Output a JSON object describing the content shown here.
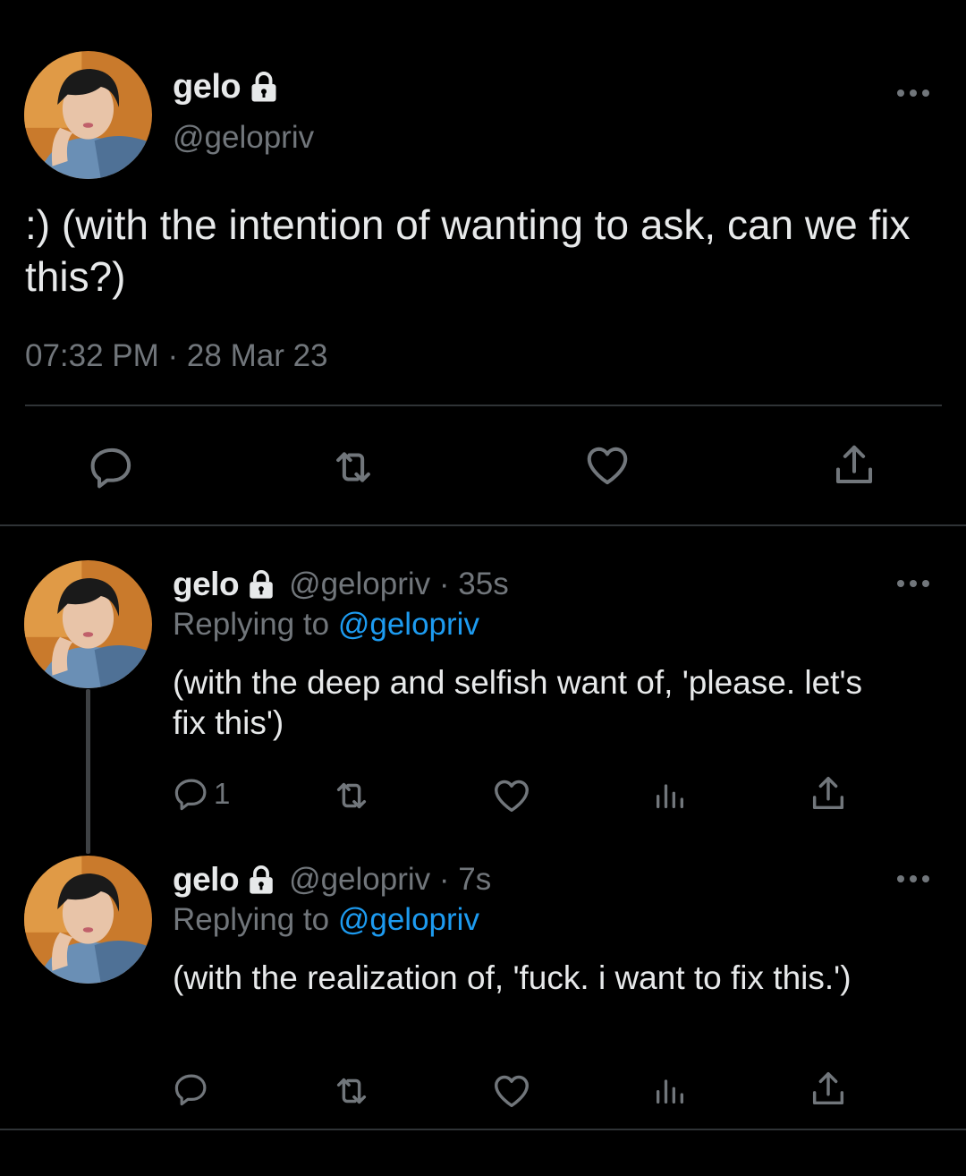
{
  "main_tweet": {
    "display_name": "gelo",
    "handle": "@gelopriv",
    "text": ":) (with the intention of wanting to ask, can we fix this?)",
    "timestamp": "07:32 PM · 28 Mar 23",
    "actions": [
      "reply-icon",
      "retweet-icon",
      "like-icon",
      "share-icon"
    ]
  },
  "replies": [
    {
      "display_name": "gelo",
      "handle_time": "@gelopriv · 35s",
      "replying_prefix": "Replying to",
      "replying_handle": "@gelopriv",
      "text": "(with the deep and selfish want of, 'please. let's fix this')",
      "reply_count": "1"
    },
    {
      "display_name": "gelo",
      "handle_time": "@gelopriv · 7s",
      "replying_prefix": "Replying to",
      "replying_handle": "@gelopriv",
      "text": "(with the realization of, 'fuck. i want to fix this.')",
      "reply_count": ""
    }
  ],
  "colors": {
    "background": "#000000",
    "text": "#e7e9ea",
    "muted": "#71767b",
    "link": "#1d9bf0",
    "divider": "#2f3336"
  }
}
